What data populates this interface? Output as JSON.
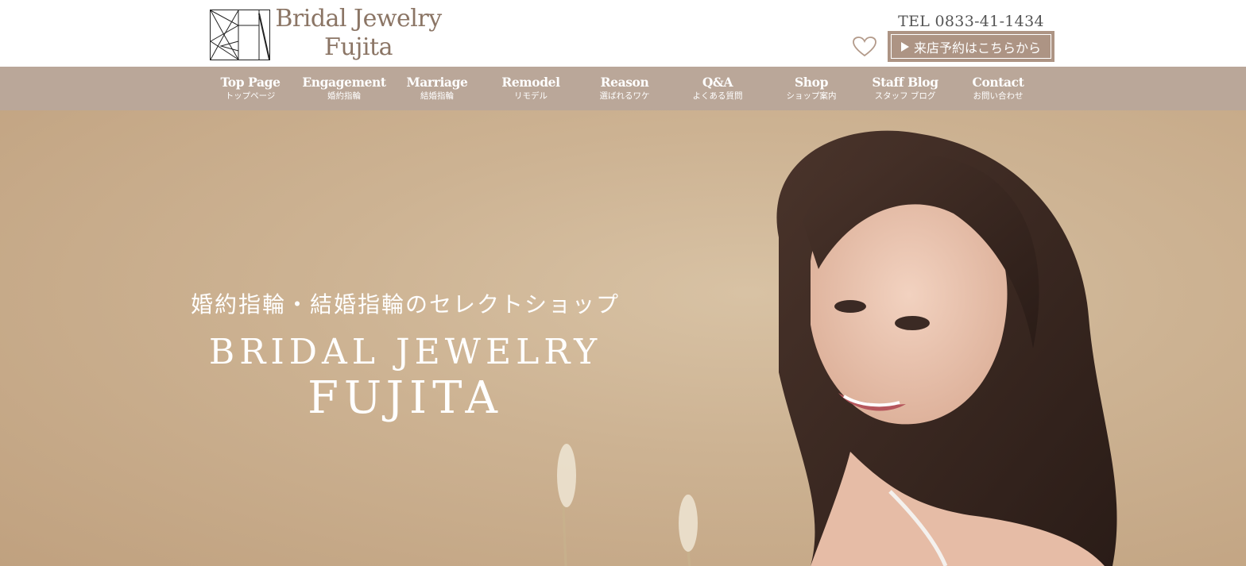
{
  "header": {
    "logo_line1": "Bridal Jewelry",
    "logo_line2": "Fujita",
    "tel": "TEL 0833-41-1434",
    "reserve_label": "来店予約はこちらから",
    "favorite_icon": "heart-icon",
    "accent_color": "#ad9484"
  },
  "nav": {
    "items": [
      {
        "en": "Top Page",
        "jp": "トップページ"
      },
      {
        "en": "Engagement",
        "jp": "婚約指輪"
      },
      {
        "en": "Marriage",
        "jp": "結婚指輪"
      },
      {
        "en": "Remodel",
        "jp": "リモデル"
      },
      {
        "en": "Reason",
        "jp": "選ばれるワケ"
      },
      {
        "en": "Q&A",
        "jp": "よくある質問"
      },
      {
        "en": "Shop",
        "jp": "ショップ案内"
      },
      {
        "en": "Staff Blog",
        "jp": "スタッフ ブログ"
      },
      {
        "en": "Contact",
        "jp": "お問い合わせ"
      }
    ],
    "background": "#baa799"
  },
  "hero": {
    "subtitle": "婚約指輪・結婚指輪のセレクトショップ",
    "brand": "BRIDAL JEWELRY",
    "name": "FUJITA"
  }
}
